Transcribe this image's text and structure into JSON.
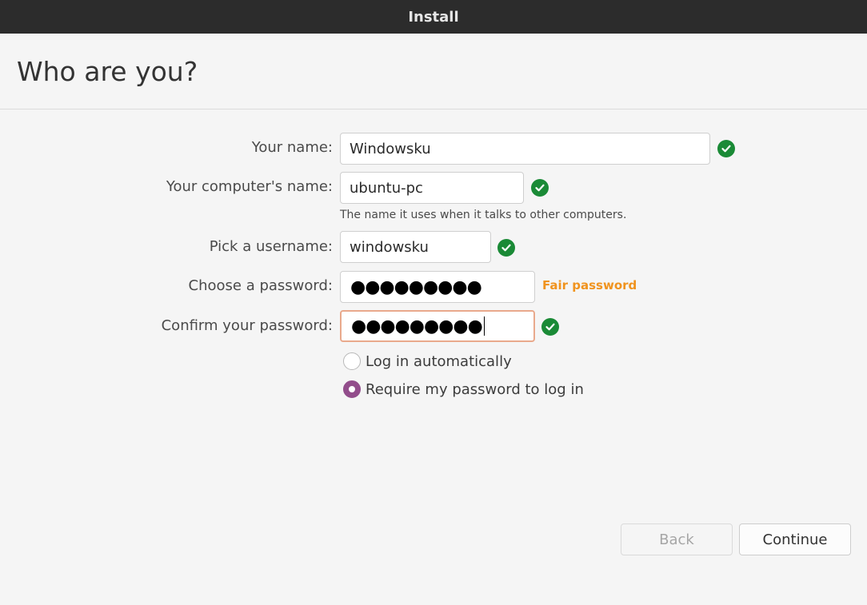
{
  "window": {
    "title": "Install"
  },
  "page": {
    "heading": "Who are you?"
  },
  "form": {
    "name": {
      "label": "Your name:",
      "value": "Windowsku"
    },
    "computer_name": {
      "label": "Your computer's name:",
      "value": "ubuntu-pc",
      "hint": "The name it uses when it talks to other computers."
    },
    "username": {
      "label": "Pick a username:",
      "value": "windowsku"
    },
    "password": {
      "label": "Choose a password:",
      "masked": "●●●●●●●●●",
      "strength": "Fair password"
    },
    "confirm_password": {
      "label": "Confirm your password:",
      "masked": "●●●●●●●●●"
    },
    "login_options": [
      {
        "label": "Log in automatically",
        "selected": false
      },
      {
        "label": "Require my password to log in",
        "selected": true
      }
    ]
  },
  "buttons": {
    "back": "Back",
    "continue": "Continue"
  },
  "icons": {
    "valid": "check-circle-icon"
  },
  "colors": {
    "valid": "#1a8a36",
    "strength_fair": "#f0931e",
    "radio_selected": "#924d8b",
    "focus_border": "#e9a98c"
  }
}
